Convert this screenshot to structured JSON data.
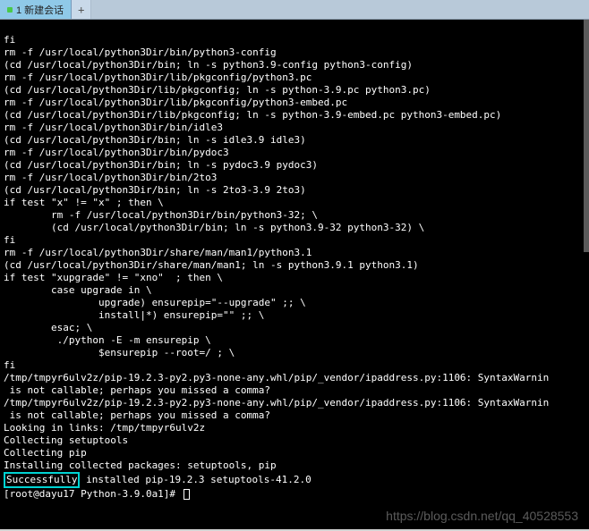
{
  "tab": {
    "label": "1 新建会话"
  },
  "tab_add": "+",
  "terminal": {
    "lines": [
      "fi",
      "rm -f /usr/local/python3Dir/bin/python3-config",
      "(cd /usr/local/python3Dir/bin; ln -s python3.9-config python3-config)",
      "rm -f /usr/local/python3Dir/lib/pkgconfig/python3.pc",
      "(cd /usr/local/python3Dir/lib/pkgconfig; ln -s python-3.9.pc python3.pc)",
      "rm -f /usr/local/python3Dir/lib/pkgconfig/python3-embed.pc",
      "(cd /usr/local/python3Dir/lib/pkgconfig; ln -s python-3.9-embed.pc python3-embed.pc)",
      "rm -f /usr/local/python3Dir/bin/idle3",
      "(cd /usr/local/python3Dir/bin; ln -s idle3.9 idle3)",
      "rm -f /usr/local/python3Dir/bin/pydoc3",
      "(cd /usr/local/python3Dir/bin; ln -s pydoc3.9 pydoc3)",
      "rm -f /usr/local/python3Dir/bin/2to3",
      "(cd /usr/local/python3Dir/bin; ln -s 2to3-3.9 2to3)",
      "if test \"x\" != \"x\" ; then \\",
      "        rm -f /usr/local/python3Dir/bin/python3-32; \\",
      "        (cd /usr/local/python3Dir/bin; ln -s python3.9-32 python3-32) \\",
      "fi",
      "rm -f /usr/local/python3Dir/share/man/man1/python3.1",
      "(cd /usr/local/python3Dir/share/man/man1; ln -s python3.9.1 python3.1)",
      "if test \"xupgrade\" != \"xno\"  ; then \\",
      "        case upgrade in \\",
      "                upgrade) ensurepip=\"--upgrade\" ;; \\",
      "                install|*) ensurepip=\"\" ;; \\",
      "        esac; \\",
      "         ./python -E -m ensurepip \\",
      "                $ensurepip --root=/ ; \\",
      "fi",
      "/tmp/tmpyr6ulv2z/pip-19.2.3-py2.py3-none-any.whl/pip/_vendor/ipaddress.py:1106: SyntaxWarnin",
      " is not callable; perhaps you missed a comma?",
      "/tmp/tmpyr6ulv2z/pip-19.2.3-py2.py3-none-any.whl/pip/_vendor/ipaddress.py:1106: SyntaxWarnin",
      " is not callable; perhaps you missed a comma?",
      "Looking in links: /tmp/tmpyr6ulv2z",
      "Collecting setuptools",
      "Collecting pip",
      "Installing collected packages: setuptools, pip"
    ],
    "success_word": "Successfully",
    "success_rest": " installed pip-19.2.3 setuptools-41.2.0",
    "masked_prompt": "[root@dayu17 Python-3.9.0a1]# "
  },
  "watermark": "https://blog.csdn.net/qq_40528553"
}
